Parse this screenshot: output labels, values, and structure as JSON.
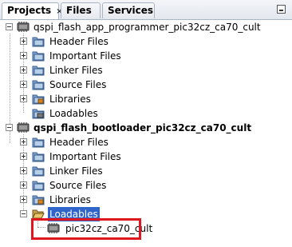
{
  "tabs": [
    {
      "label": "Projects",
      "close": "×"
    },
    {
      "label": "Files"
    },
    {
      "label": "Services"
    }
  ],
  "projects": [
    {
      "name": "qspi_flash_app_programmer_pic32cz_ca70_cult",
      "children": [
        "Header Files",
        "Important Files",
        "Linker Files",
        "Source Files",
        "Libraries",
        "Loadables"
      ]
    },
    {
      "name": "qspi_flash_bootloader_pic32cz_ca70_cult",
      "children": [
        "Header Files",
        "Important Files",
        "Linker Files",
        "Source Files",
        "Libraries",
        "Loadables"
      ],
      "loadable_item": "pic32cz_ca70_cult"
    }
  ],
  "colors": {
    "selection": "#2f65ca",
    "highlight_box": "#e0161e"
  }
}
